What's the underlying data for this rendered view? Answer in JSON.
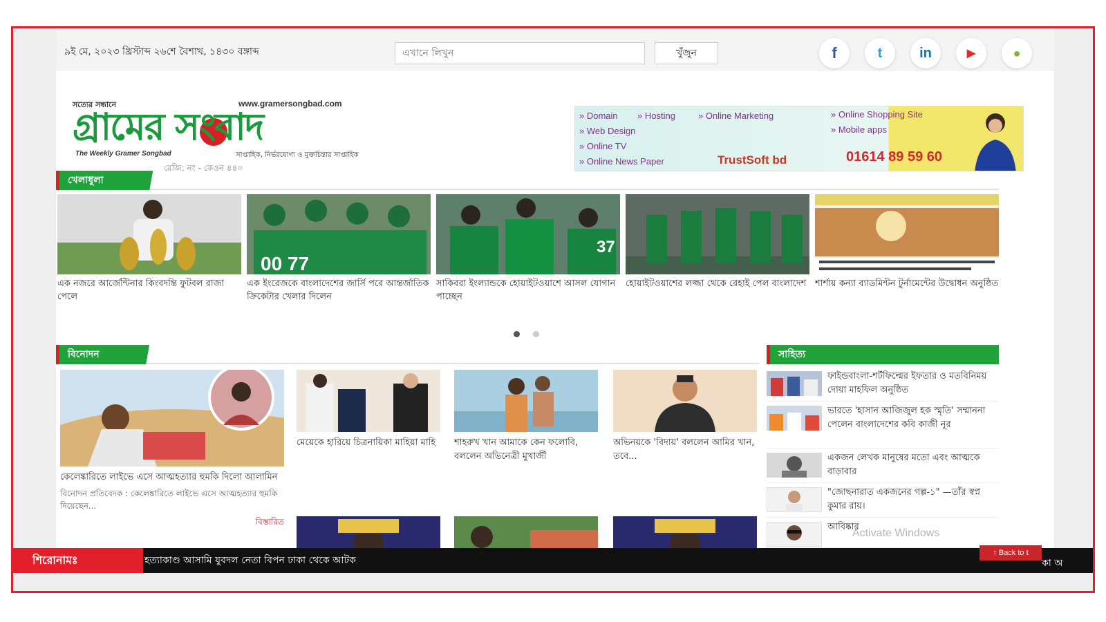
{
  "topbar": {
    "date": "৯ই মে, ২০২৩ খ্রিস্টাব্দ ২৬শে বৈশাখ, ১৪৩০ বঙ্গাব্দ",
    "search_placeholder": "এখানে লিখুন",
    "search_button": "খুঁজুন",
    "social": [
      {
        "name": "facebook-icon",
        "glyph": "f",
        "color": "#3b5998"
      },
      {
        "name": "twitter-icon",
        "glyph": "t",
        "color": "#1da1f2"
      },
      {
        "name": "linkedin-icon",
        "glyph": "in",
        "color": "#0e76a8"
      },
      {
        "name": "youtube-icon",
        "glyph": "▶",
        "color": "#e52d27"
      },
      {
        "name": "android-icon",
        "glyph": "●",
        "color": "#7cb342"
      }
    ]
  },
  "header": {
    "logo_tagline": "সত্যের সন্ধানে",
    "logo_website": "www.gramersongbad.com",
    "logo_text": "গ্রামের সংবাদ",
    "logo_english": "The Weekly Gramer Songbad",
    "logo_subtitle": "সাপ্তাহিক, নির্ভরযোগ্য ও মুক্তচিন্তার সাপ্তাহিক",
    "logo_registration": "রেজি: নং - কেওন ৪৪০",
    "banner": {
      "items": [
        "» Domain",
        "» Hosting",
        "» Online Marketing",
        "» Online Shopping Site",
        "» Web Design",
        "» Mobile apps",
        "» Online TV",
        "» Online News Paper"
      ],
      "brand": "TrustSoft bd",
      "phone": "01614 89 59 60"
    }
  },
  "sports": {
    "section_title": "খেলাধুলা",
    "cards": [
      {
        "title": "এক নজরে আর্জেন্টিনার কিংবদন্তি ফুটবল রাজা পেলে"
      },
      {
        "title": "এক ইংরেজকে বাংলাদেশের জার্সি পরে আন্তর্জাতিক ক্রিকেটার খেলার দিলেন"
      },
      {
        "title": "সাকিবরা ইংল্যান্ডকে হোয়াইটওয়াশে আসল যোগান পাচ্ছেন"
      },
      {
        "title": "হোয়াইটওয়াশের লজ্জা থেকে রেহাই পেল বাংলাদেশ"
      },
      {
        "title": "শার্শায় কন্যা ব্যাডমিন্টন টুর্নামেন্টের উদ্বোধন অনুষ্ঠিত"
      }
    ]
  },
  "entertainment": {
    "section_title": "বিনোদন",
    "lead": {
      "title": "কেলেঙ্কারিতে লাইভে এসে আত্মহত্যার হুমকি দিলো আলামিন",
      "summary": "বিনোদন প্রতিবেদক : কেলেঙ্কারিতে লাইভে এসে আত্মহত্যার হুমকি দিয়েছেন...",
      "more": "বিস্তারিত"
    },
    "cards": [
      {
        "title": "মেয়েকে হারিয়ে চিত্রনায়িকা মাহিয়া মাহি"
      },
      {
        "title": "শাহরুখ খান আমাকে কেন ফলোবি, বললেন অভিনেত্রী মুখার্জী"
      },
      {
        "title": "অভিনয়কে 'বিদায়' বললেন আমির খান, তবে..."
      }
    ]
  },
  "literature": {
    "section_title": "সাহিত্য",
    "items": [
      {
        "title": "ফাইন্ডবাংলা-শর্টফিল্মের ইফতার ও মতবিনিময় দোয়া মাহফিল অনুষ্ঠিত"
      },
      {
        "title": "ভারতে 'হাসান আজিজুল হক স্মৃতি' সম্মাননা পেলেন বাংলাদেশের কবি কাজী নূর"
      },
      {
        "title": "একজন লেখক মানুষের মতো এবং আত্মকে বাড়াবার"
      },
      {
        "title": "\"জোছনারাত একজনের গল্প-১\" —তাঁর স্বপ্ন কুমার রায়।"
      },
      {
        "title": "আবিষ্কার"
      }
    ]
  },
  "ticker": {
    "label": "শিরোনামঃ",
    "text": "হত্যাকাণ্ড আসামি যুবদল নেতা বিপন ঢাকা থেকে আটক",
    "right_text": "কা অ"
  },
  "back_to_top": "↑ Back to t",
  "os_watermark": "Activate Windows",
  "colors": {
    "brand_green": "#1fa33a",
    "brand_red": "#d91f26",
    "ticker_bg": "#111111"
  }
}
